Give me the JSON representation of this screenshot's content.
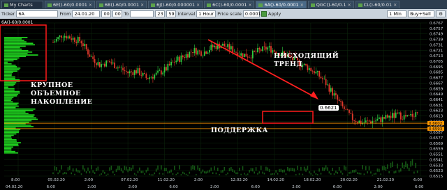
{
  "tabs": [
    {
      "label": "My Charts",
      "active": false
    },
    {
      "label": "6E()-60/0.0001",
      "active": false
    },
    {
      "label": "6B()-60/0.0001",
      "active": false
    },
    {
      "label": "6J()-60/0.000001",
      "active": false
    },
    {
      "label": "6C()-60/0.0001",
      "active": false
    },
    {
      "label": "6A()-60/0.0001",
      "active": true
    },
    {
      "label": "QGC()-60/0.1",
      "active": false
    },
    {
      "label": "CL()-60/0.01",
      "active": false
    }
  ],
  "toolbar": {
    "ticker_label": "Ticker",
    "ticker_value": "6A",
    "from_label": "From",
    "from_value": "24.01.20",
    "hour_value": "00",
    "min_value": "00",
    "to_label": "To",
    "to_hour": "23",
    "to_min": "59",
    "interval_label": "Interval",
    "interval_value": "1 Hour",
    "price_scale_label": "Price scale",
    "price_scale_value": "0.0001",
    "apply_label": "Apply",
    "timeframe_value": "1 Min",
    "side_value": "Buy+Sell"
  },
  "chart": {
    "corner_label": "6A()-60/0.0001",
    "annotations": {
      "trend": [
        "НИСХОДЯЩИЙ",
        "ТРЕНД"
      ],
      "accumulation": [
        "КРУПНОЕ",
        "ОБЪЕМНОЕ",
        "НАКОПЛЕНИЕ"
      ],
      "support": "ПОДДЕРЖКА"
    },
    "current_price": "0.6621",
    "level_labels": [
      "0.6602",
      "0.6593"
    ],
    "colors": {
      "up": "#2ecc40",
      "down": "#e0392b",
      "support_line": "#ff9900",
      "box": "#ff1a1a",
      "arrow": "#ff2020",
      "volume": "#1fd11f"
    }
  },
  "chart_data": {
    "type": "candlestick",
    "y_ticks": [
      "0.6767",
      "0.6757",
      "0.6749",
      "0.6739",
      "0.6731",
      "0.6721",
      "0.6713",
      "0.6705",
      "0.6695",
      "0.6685",
      "0.6677",
      "0.6667",
      "0.6659",
      "0.6649",
      "0.6641",
      "0.6631",
      "0.6623",
      "0.6613",
      "0.6603",
      "0.6595",
      "0.6587",
      "0.6577",
      "0.6569",
      "0.6559",
      "0.6551",
      "0.6541",
      "0.6533",
      "0.6523",
      "0.6515"
    ],
    "x_ticks": [
      "8:00",
      "05.02.20",
      "2:00",
      "07.02.20",
      "11.02.20",
      "2:00",
      "12.02.20",
      "14.02.20",
      "18.02.20",
      "20.02.20",
      "21.02.20",
      "6:00"
    ],
    "x_ticks_bottom": [
      "04.02.20",
      "6:00",
      "2:00",
      "2:00",
      "6:00",
      "2:00",
      "6:00",
      "2:00",
      "6:00",
      "2:00",
      "6:00"
    ],
    "close_path": [
      0.6735,
      0.6748,
      0.6742,
      0.6737,
      0.6712,
      0.6698,
      0.6703,
      0.6694,
      0.6685,
      0.6688,
      0.6676,
      0.6682,
      0.669,
      0.6704,
      0.6712,
      0.6722,
      0.6718,
      0.6727,
      0.6731,
      0.6725,
      0.6716,
      0.6713,
      0.6721,
      0.6726,
      0.6719,
      0.6714,
      0.6704,
      0.6696,
      0.6687,
      0.6672,
      0.665,
      0.6628,
      0.661,
      0.6603,
      0.6605,
      0.6608,
      0.6613,
      0.6615,
      0.6611,
      0.6621
    ]
  }
}
